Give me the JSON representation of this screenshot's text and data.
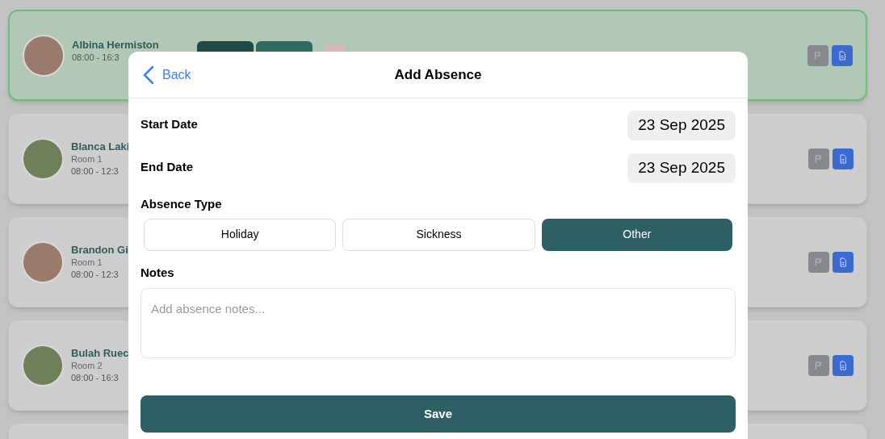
{
  "children_list": [
    {
      "name": "Albina Hermiston",
      "time": "08:00 - 16:3",
      "selected": true
    },
    {
      "name": "Blanca Laki",
      "room": "Room 1",
      "time": "08:00 - 12:3",
      "selected": false
    },
    {
      "name": "Brandon Gi",
      "room": "Room 1",
      "time": "08:00 - 12:3",
      "selected": false
    },
    {
      "name": "Bulah Ruec",
      "room": "Room 2",
      "time": "08:00 - 16:3",
      "selected": false
    },
    {
      "selected": false
    }
  ],
  "dialog": {
    "back": "Back",
    "title": "Add Absence",
    "start_date": {
      "label": "Start Date",
      "value": "23 Sep 2025"
    },
    "end_date": {
      "label": "End Date",
      "value": "23 Sep 2025"
    },
    "absence_type": {
      "label": "Absence Type",
      "options": [
        {
          "label": "Holiday",
          "selected": false
        },
        {
          "label": "Sickness",
          "selected": false
        },
        {
          "label": "Other",
          "selected": true
        }
      ]
    },
    "notes": {
      "label": "Notes",
      "placeholder": "Add absence notes..."
    },
    "save": "Save"
  }
}
